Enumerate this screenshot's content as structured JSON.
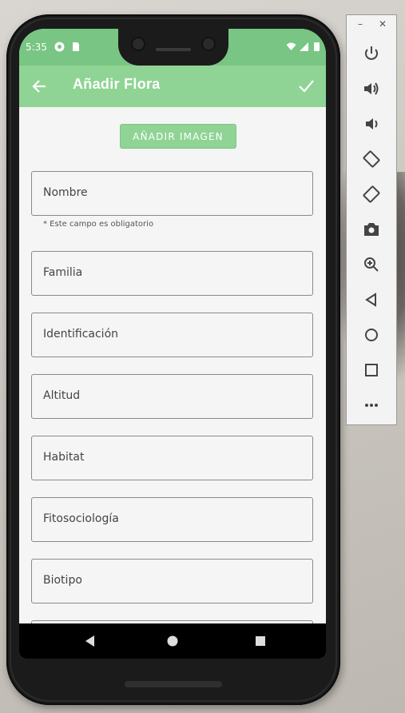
{
  "status_bar": {
    "time": "5:35"
  },
  "app_bar": {
    "title": "Añadir Flora"
  },
  "form": {
    "add_image_label": "AÑADIR IMAGEN",
    "fields": [
      {
        "label": "Nombre"
      },
      {
        "label": "Familia"
      },
      {
        "label": "Identificación"
      },
      {
        "label": "Altitud"
      },
      {
        "label": "Habitat"
      },
      {
        "label": "Fitosociología"
      },
      {
        "label": "Biotipo"
      }
    ],
    "required_helper": "* Este campo es obligatorio"
  },
  "colors": {
    "app_bar": "#8fd494",
    "status_bar": "#79c583",
    "button": "#8fd494"
  },
  "emulator_panel": {
    "window_controls": [
      "minimize",
      "close"
    ],
    "buttons": [
      "power-icon",
      "volume-up-icon",
      "volume-down-icon",
      "rotate-left-icon",
      "rotate-right-icon",
      "camera-icon",
      "zoom-icon",
      "back-icon",
      "home-icon",
      "overview-icon",
      "more-icon"
    ]
  }
}
